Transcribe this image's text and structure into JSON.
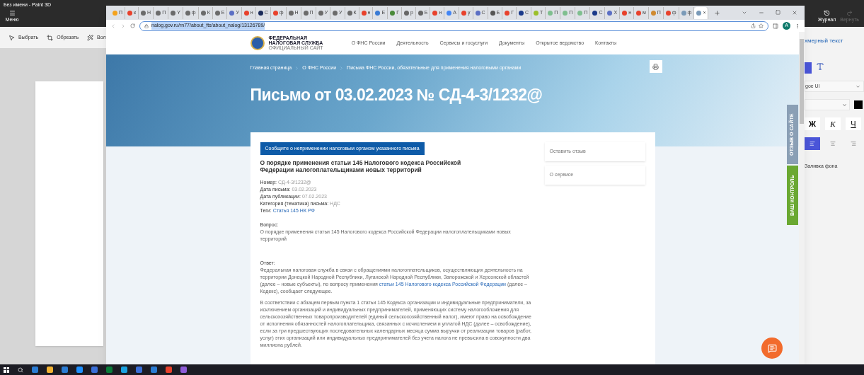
{
  "paint": {
    "title": "Без имени - Paint 3D",
    "menu_label": "Меню",
    "tools": [
      {
        "kind": "select",
        "label": "Выбрать"
      },
      {
        "kind": "crop",
        "label": "Обрезать"
      },
      {
        "kind": "magic",
        "label": "Вол"
      }
    ],
    "history": [
      {
        "kind": "journal",
        "label": "Журнал",
        "disabled": false
      },
      {
        "kind": "redo",
        "label": "Вернуть",
        "disabled": true
      }
    ],
    "panel": {
      "title": "хмерный текст",
      "font": "goe UI",
      "styles": [
        "Ж",
        "К",
        "Ч"
      ],
      "fill_label": "Заливка фона"
    }
  },
  "browser": {
    "tabs": [
      {
        "label": "П",
        "color": "#f4a21c",
        "selected": false
      },
      {
        "label": "к",
        "color": "#e8412c",
        "selected": false
      },
      {
        "label": "Н",
        "color": "#6b6b6b",
        "selected": false
      },
      {
        "label": "П",
        "color": "#6b6b6b",
        "selected": false
      },
      {
        "label": "Y",
        "color": "#6b6b6b",
        "selected": false
      },
      {
        "label": "ф",
        "color": "#6b6b6b",
        "selected": false
      },
      {
        "label": "К",
        "color": "#6b6b6b",
        "selected": false
      },
      {
        "label": "Е",
        "color": "#6b6b6b",
        "selected": false
      },
      {
        "label": "У",
        "color": "#5b6fc4",
        "selected": false
      },
      {
        "label": "н",
        "color": "#e8412c",
        "selected": false
      },
      {
        "label": "С",
        "color": "#1b2b5a",
        "selected": false
      },
      {
        "label": "ф",
        "color": "#e8412c",
        "selected": false
      },
      {
        "label": "Н",
        "color": "#6b6b6b",
        "selected": false
      },
      {
        "label": "П",
        "color": "#6b6b6b",
        "selected": false
      },
      {
        "label": "У",
        "color": "#6b6b6b",
        "selected": false
      },
      {
        "label": "У",
        "color": "#6b6b6b",
        "selected": false
      },
      {
        "label": "К",
        "color": "#6b6b6b",
        "selected": false
      },
      {
        "label": "н",
        "color": "#e8412c",
        "selected": false
      },
      {
        "label": "Е",
        "color": "#3a7bd5",
        "selected": false
      },
      {
        "label": "Г",
        "color": "#4a8a3a",
        "selected": false
      },
      {
        "label": "р",
        "color": "#666666",
        "selected": false
      },
      {
        "label": "Б",
        "color": "#666666",
        "selected": false
      },
      {
        "label": "н",
        "color": "#e8412c",
        "selected": false
      },
      {
        "label": "А",
        "color": "#4285f4",
        "selected": false
      },
      {
        "label": "у",
        "color": "#e8412c",
        "selected": false
      },
      {
        "label": "С",
        "color": "#5b6fc4",
        "selected": false
      },
      {
        "label": "Б",
        "color": "#555555",
        "selected": false
      },
      {
        "label": "Г",
        "color": "#e8412c",
        "selected": false
      },
      {
        "label": "С",
        "color": "#1a3a8a",
        "selected": false
      },
      {
        "label": "Т",
        "color": "#9bbf2a",
        "selected": false
      },
      {
        "label": "П",
        "color": "#7fbf8f",
        "selected": false
      },
      {
        "label": "П",
        "color": "#7fbf8f",
        "selected": false
      },
      {
        "label": "П",
        "color": "#7fbf8f",
        "selected": false
      },
      {
        "label": "С",
        "color": "#1a3a8a",
        "selected": false
      },
      {
        "label": "Х",
        "color": "#5b6fc4",
        "selected": false
      },
      {
        "label": "н",
        "color": "#e8412c",
        "selected": false
      },
      {
        "label": "м",
        "color": "#e8412c",
        "selected": false
      },
      {
        "label": "П",
        "color": "#d08a30",
        "selected": false
      },
      {
        "label": "ф",
        "color": "#e8412c",
        "selected": false
      },
      {
        "label": "ф",
        "color": "#7a9ab8",
        "selected": false
      },
      {
        "label": "×",
        "color": "#7a9ab8",
        "selected": true
      }
    ],
    "url": "nalog.gov.ru/rn77/about_fts/about_nalog/13126789/",
    "profile": "A"
  },
  "site": {
    "logo": {
      "line1": "ФЕДЕРАЛЬНАЯ",
      "line2": "НАЛОГОВАЯ СЛУЖБА",
      "line3": "ОФИЦИАЛЬНЫЙ САЙТ"
    },
    "nav": [
      "О ФНС России",
      "Деятельность",
      "Сервисы и госуслуги",
      "Документы",
      "Открытое ведомство",
      "Контакты"
    ],
    "breadcrumbs": [
      "Главная страница",
      "О ФНС России",
      "Письма ФНС России, обязательные для применения налоговыми органами"
    ],
    "title": "Письмо от 03.02.2023 № СД-4-3/1232@",
    "report_button": "Сообщите о неприменении налоговым органом указанного письма",
    "heading": "О порядке применения статьи 145 Налогового кодекса Российской Федерации налогоплательщиками новых территорий",
    "meta": [
      {
        "label": "Номер:",
        "value": "СД-4-3/1232@",
        "kind": "text"
      },
      {
        "label": "Дата письма:",
        "value": "03.02.2023",
        "kind": "text"
      },
      {
        "label": "Дата публикации:",
        "value": "07.02.2023",
        "kind": "text"
      },
      {
        "label": "Категория (тематика) письма:",
        "value": "НДС",
        "kind": "text"
      },
      {
        "label": "Теги:",
        "value": "Статья 145 НК РФ",
        "kind": "link"
      }
    ],
    "question_label": "Вопрос:",
    "question": "О порядке применения статьи 145 Налогового кодекса Российской Федерации налогоплательщиками новых территорий",
    "answer_label": "Ответ:",
    "answer_before": "Федеральная налоговая служба в связи с обращениями налогоплательщиков, осуществляющих деятельность на территории Донецкой Народной Республики, Луганской Народной Республики, Запорожской и Херсонской областей (далее – новые субъекты), по вопросу применения",
    "answer_link": "статьи 145 Налогового кодекса Российской Федерации",
    "answer_after": "(далее – Кодекс), сообщает следующее.",
    "paragraph": "В соответствии с абзацем первым пункта 1 статьи 145 Кодекса организации и индивидуальные предприниматели, за исключением организаций и индивидуальных предпринимателей, применяющих систему налогообложения для сельскохозяйственных товаропроизводителей (единый сельскохозяйственный налог), имеют право на освобождение от исполнения обязанностей налогоплательщика, связанных с исчислением и уплатой НДС (далее – освобождение), если за три предшествующих последовательных календарных месяца сумма выручки от реализации товаров (работ, услуг) этих организаций или индивидуальных предпринимателей без учета налога не превысила в совокупности два миллиона рублей.",
    "side_links": [
      "Оставить отзыв",
      "О сервисе"
    ],
    "side_tabs": [
      {
        "label": "ОТЗЫВ О САЙТЕ",
        "color": "#8a9fb5"
      },
      {
        "label": "ВАШ КОНТРОЛЬ",
        "color": "#6aa832"
      }
    ]
  }
}
